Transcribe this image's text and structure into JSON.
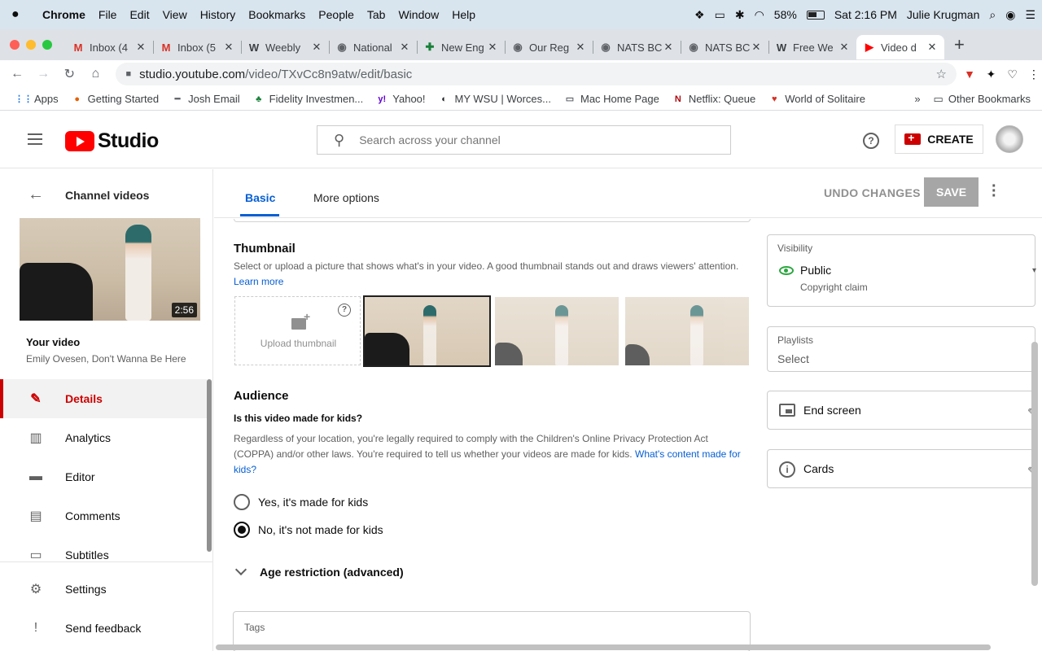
{
  "menubar": {
    "items": [
      "Chrome",
      "File",
      "Edit",
      "View",
      "History",
      "Bookmarks",
      "People",
      "Tab",
      "Window",
      "Help"
    ],
    "battery": "58%",
    "clock": "Sat 2:16 PM",
    "user": "Julie Krugman"
  },
  "tabs": [
    {
      "icon": "gmail-icon",
      "glyph": "M",
      "color": "#d93025",
      "title": "Inbox (4"
    },
    {
      "icon": "gmail-icon",
      "glyph": "M",
      "color": "#d93025",
      "title": "Inbox (5"
    },
    {
      "icon": "weebly-icon",
      "glyph": "W",
      "color": "#3c4043",
      "title": "Weebly"
    },
    {
      "icon": "globe-icon",
      "glyph": "◉",
      "color": "#5f6368",
      "title": "National"
    },
    {
      "icon": "green-plus-icon",
      "glyph": "✚",
      "color": "#188038",
      "title": "New Eng"
    },
    {
      "icon": "globe-icon",
      "glyph": "◉",
      "color": "#5f6368",
      "title": "Our Reg"
    },
    {
      "icon": "globe-icon",
      "glyph": "◉",
      "color": "#5f6368",
      "title": "NATS BC"
    },
    {
      "icon": "globe-icon",
      "glyph": "◉",
      "color": "#5f6368",
      "title": "NATS BC"
    },
    {
      "icon": "weebly-icon",
      "glyph": "W",
      "color": "#3c4043",
      "title": "Free We"
    },
    {
      "icon": "youtube-icon",
      "glyph": "▶",
      "color": "#ff0000",
      "title": "Video d"
    }
  ],
  "url": {
    "host": "studio.youtube.com",
    "path": "/video/TXvCc8n9atw/edit/basic"
  },
  "bookmarks": [
    {
      "icon": "apps-grid-icon",
      "glyph": "⋮⋮",
      "color": "#1a73e8",
      "label": "Apps"
    },
    {
      "icon": "firefox-icon",
      "glyph": "●",
      "color": "#e66000",
      "label": "Getting Started"
    },
    {
      "icon": "dash-icon",
      "glyph": "━",
      "color": "#5f6368",
      "label": "Josh Email"
    },
    {
      "icon": "fidelity-icon",
      "glyph": "♣",
      "color": "#188038",
      "label": "Fidelity Investmen..."
    },
    {
      "icon": "yahoo-icon",
      "glyph": "y!",
      "color": "#6001d2",
      "label": "Yahoo!"
    },
    {
      "icon": "globe-icon",
      "glyph": "◐",
      "color": "#202124",
      "label": "MY WSU | Worces..."
    },
    {
      "icon": "apple-page-icon",
      "glyph": "▭",
      "color": "#5f6368",
      "label": "Mac Home Page"
    },
    {
      "icon": "netflix-icon",
      "glyph": "N",
      "color": "#b00710",
      "label": "Netflix: Queue"
    },
    {
      "icon": "solitaire-icon",
      "glyph": "♥",
      "color": "#d93025",
      "label": "World of Solitaire"
    }
  ],
  "bookmarks_overflow": "»",
  "other_bookmarks": "Other Bookmarks",
  "studio": {
    "logo_text": "Studio",
    "search_placeholder": "Search across your channel",
    "create_label": "CREATE"
  },
  "sidebar": {
    "back_label": "Channel videos",
    "duration": "2:56",
    "your_video": "Your video",
    "video_title": "Emily Ovesen, Don't Wanna Be Here",
    "nav": [
      {
        "name": "details",
        "label": "Details",
        "icon": "pencil-icon",
        "glyph": "✎",
        "active": true
      },
      {
        "name": "analytics",
        "label": "Analytics",
        "icon": "analytics-icon",
        "glyph": "▥",
        "active": false
      },
      {
        "name": "editor",
        "label": "Editor",
        "icon": "clapper-icon",
        "glyph": "▬",
        "active": false
      },
      {
        "name": "comments",
        "label": "Comments",
        "icon": "comment-icon",
        "glyph": "▤",
        "active": false
      },
      {
        "name": "subtitles",
        "label": "Subtitles",
        "icon": "subtitles-icon",
        "glyph": "▭",
        "active": false
      }
    ],
    "bottom": [
      {
        "name": "settings",
        "label": "Settings",
        "icon": "gear-icon",
        "glyph": "⚙"
      },
      {
        "name": "send-feedback",
        "label": "Send feedback",
        "icon": "feedback-icon",
        "glyph": "!"
      }
    ]
  },
  "editor": {
    "tab_basic": "Basic",
    "tab_more": "More options",
    "undo": "UNDO CHANGES",
    "save": "SAVE",
    "thumbnail": {
      "title": "Thumbnail",
      "desc": "Select or upload a picture that shows what's in your video. A good thumbnail stands out and draws viewers' attention.",
      "link": "Learn more",
      "upload": "Upload thumbnail"
    },
    "audience": {
      "title": "Audience",
      "question": "Is this video made for kids?",
      "desc": "Regardless of your location, you're legally required to comply with the Children's Online Privacy Protection Act (COPPA) and/or other laws. You're required to tell us whether your videos are made for kids.",
      "link": "What's content made for kids?",
      "yes": "Yes, it's made for kids",
      "no": "No, it's not made for kids",
      "selected": "no"
    },
    "age_restriction": "Age restriction (advanced)",
    "tags_label": "Tags"
  },
  "right_panel": {
    "visibility_label": "Visibility",
    "visibility_value": "Public",
    "visibility_note": "Copyright claim",
    "playlists_label": "Playlists",
    "playlists_value": "Select",
    "end_screen": "End screen",
    "cards": "Cards"
  },
  "colors": {
    "accent_red": "#cc0000",
    "link_blue": "#065fd4",
    "public_green": "#2ba640"
  }
}
